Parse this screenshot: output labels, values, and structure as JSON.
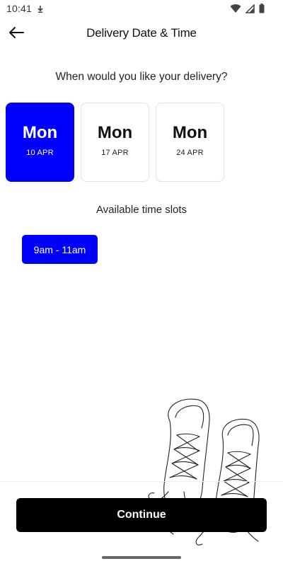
{
  "status_bar": {
    "time": "10:41"
  },
  "header": {
    "title": "Delivery Date & Time"
  },
  "question": "When would you like your delivery?",
  "dates": [
    {
      "day": "Mon",
      "date": "10 APR",
      "selected": true
    },
    {
      "day": "Mon",
      "date": "17 APR",
      "selected": false
    },
    {
      "day": "Mon",
      "date": "24 APR",
      "selected": false
    }
  ],
  "time_slots": {
    "heading": "Available time slots",
    "slots": [
      "9am - 11am"
    ]
  },
  "footer": {
    "continue_label": "Continue"
  },
  "colors": {
    "accent": "#0000ff",
    "primary_button": "#000000"
  },
  "icons": {
    "back": "arrow-left-icon",
    "status_left": "location-icon",
    "wifi": "wifi-icon",
    "signal": "cell-signal-icon",
    "battery": "battery-icon"
  }
}
